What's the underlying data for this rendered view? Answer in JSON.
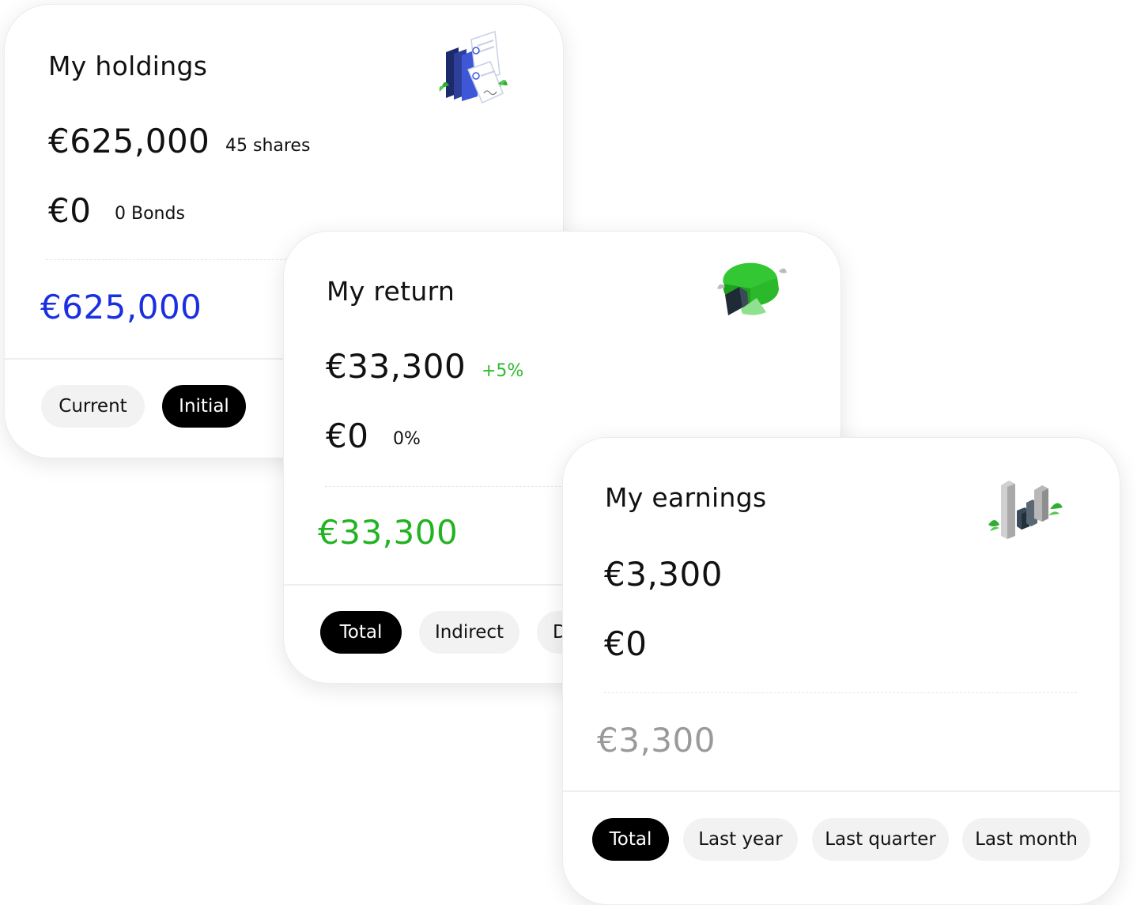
{
  "holdings": {
    "title": "My holdings",
    "shares_amount": "€625,000",
    "shares_label": "45 shares",
    "bonds_amount": "€0",
    "bonds_label": "0 Bonds",
    "total": "€625,000",
    "total_color": "#1a2fe0",
    "tabs": [
      {
        "label": "Current",
        "active": false
      },
      {
        "label": "Initial",
        "active": true
      }
    ],
    "icon": "documents-icon"
  },
  "return": {
    "title": "My return",
    "amount_primary": "€33,300",
    "change_primary": "+5%",
    "change_color": "#2dbb2d",
    "amount_secondary": "€0",
    "change_secondary": "0%",
    "total": "€33,300",
    "total_color": "#22b322",
    "tabs": [
      {
        "label": "Total",
        "active": true
      },
      {
        "label": "Indirect",
        "active": false
      },
      {
        "label": "D",
        "active": false
      }
    ],
    "icon": "pie-chart-icon"
  },
  "earnings": {
    "title": "My earnings",
    "amount_primary": "€3,300",
    "amount_secondary": "€0",
    "total": "€3,300",
    "total_color": "#9a9a9a",
    "tabs": [
      {
        "label": "Total",
        "active": true
      },
      {
        "label": "Last year",
        "active": false
      },
      {
        "label": "Last quarter",
        "active": false
      },
      {
        "label": "Last month",
        "active": false
      }
    ],
    "icon": "bar-chart-icon"
  }
}
